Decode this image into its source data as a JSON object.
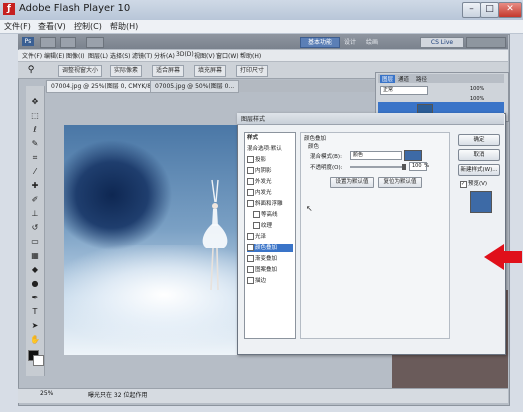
{
  "window": {
    "title": "Adobe Flash Player 10",
    "menu": [
      "文件(F)",
      "查看(V)",
      "控制(C)",
      "帮助(H)"
    ],
    "controls": {
      "minimize": "–",
      "maximize": "□",
      "close": "✕"
    }
  },
  "ps": {
    "workspace_buttons": [
      "基本功能",
      "设计",
      "绘画"
    ],
    "cslive_label": "CS Live",
    "menu": [
      "文件(F)",
      "编辑(E)",
      "图像(I)",
      "图层(L)",
      "选择(S)",
      "滤镜(T)",
      "分析(A)",
      "3D(D)",
      "视图(V)",
      "窗口(W)",
      "帮助(H)"
    ],
    "options": [
      "调整视窗大小",
      "实际像素",
      "适合屏幕",
      "填充屏幕",
      "打印尺寸"
    ],
    "tabs": [
      "07004.jpg @ 25%(图层 0, CMYK/8) *",
      "07005.jpg @ 50%(图层 0..."
    ],
    "status_left": "25%",
    "status_text": "曝光只在 32 位起作用"
  },
  "layers_panel": {
    "tabs": [
      "图层",
      "通道",
      "路径"
    ],
    "mode": "正常",
    "opacity": "100%",
    "fill": "100%"
  },
  "dialog": {
    "title": "图层样式",
    "list": [
      "样式",
      "混合选项:默认",
      "投影",
      "内阴影",
      "外发光",
      "内发光",
      "斜面和浮雕",
      "等高线",
      "纹理",
      "光泽",
      "颜色叠加",
      "渐变叠加",
      "图案叠加",
      "描边"
    ],
    "selected_index": 10,
    "section_title": "颜色叠加",
    "group_title": "颜色",
    "blend_label": "混合模式(B):",
    "blend_value": "颜色",
    "opacity_label": "不透明度(O):",
    "opacity_value": "100",
    "opacity_unit": "%",
    "btn_default": "设置为默认值",
    "btn_reset": "复位为默认值",
    "ok": "确定",
    "cancel": "取消",
    "new_style": "新建样式(W)...",
    "preview": "预览(V)",
    "swatch_color": "#3d6aa6"
  },
  "accent_arrow_color": "#e0101a"
}
